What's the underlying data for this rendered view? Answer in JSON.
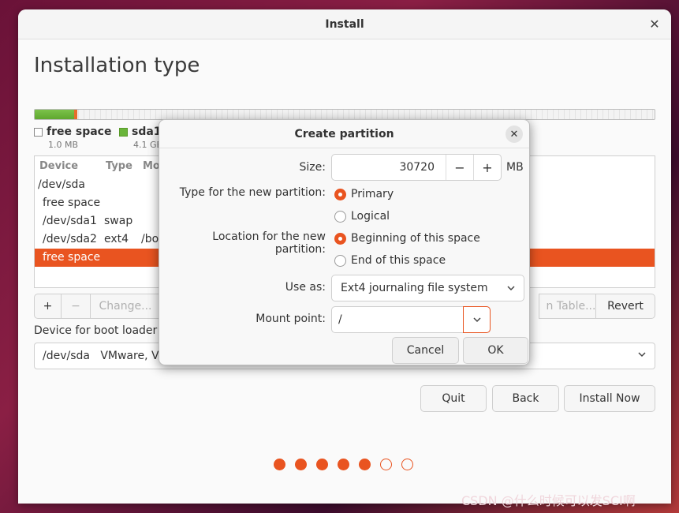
{
  "window": {
    "title": "Install",
    "close_icon": "close-icon"
  },
  "page": {
    "title": "Installation type"
  },
  "partition_bar": {
    "colors": {
      "free": "#f3f3f3",
      "sda1": "#6ab53a",
      "sda2": "#e66d2a"
    }
  },
  "legend": [
    {
      "name": "free space",
      "size": "1.0 MB",
      "color": "#ffffff"
    },
    {
      "name": "sda1",
      "size": "4.1 GB",
      "color": "#6ab53a"
    }
  ],
  "table": {
    "headers": {
      "device": "Device",
      "type": "Type",
      "mount": "Mo"
    },
    "rows": [
      {
        "device": "/dev/sda",
        "type": "",
        "mount": ""
      },
      {
        "device": "free space",
        "type": "",
        "mount": ""
      },
      {
        "device": "/dev/sda1",
        "type": "swap",
        "mount": ""
      },
      {
        "device": "/dev/sda2",
        "type": "ext4",
        "mount": "/bo"
      },
      {
        "device": "free space",
        "type": "",
        "mount": ""
      }
    ]
  },
  "toolbar": {
    "add": "+",
    "remove": "−",
    "change": "Change...",
    "new_table": "n Table...",
    "revert": "Revert"
  },
  "boot_loader": {
    "label": "Device for boot loader i",
    "value": "/dev/sda   VMware, V"
  },
  "nav": {
    "quit": "Quit",
    "back": "Back",
    "install_now": "Install Now"
  },
  "progress": {
    "steps_total": 7,
    "steps_done": 5
  },
  "watermark": "CSDN @什么时候可以发SCI啊",
  "dialog": {
    "title": "Create partition",
    "size_label": "Size:",
    "size_value": "30720",
    "size_unit": "MB",
    "minus": "−",
    "plus": "+",
    "type_label": "Type for the new partition:",
    "type_options": [
      "Primary",
      "Logical"
    ],
    "type_selected": "Primary",
    "location_label": "Location for the new partition:",
    "location_options": [
      "Beginning of this space",
      "End of this space"
    ],
    "location_selected": "Beginning of this space",
    "use_as_label": "Use as:",
    "use_as_value": "Ext4 journaling file system",
    "mount_label": "Mount point:",
    "mount_value": "/",
    "cancel": "Cancel",
    "ok": "OK"
  },
  "accent": "#e95420"
}
